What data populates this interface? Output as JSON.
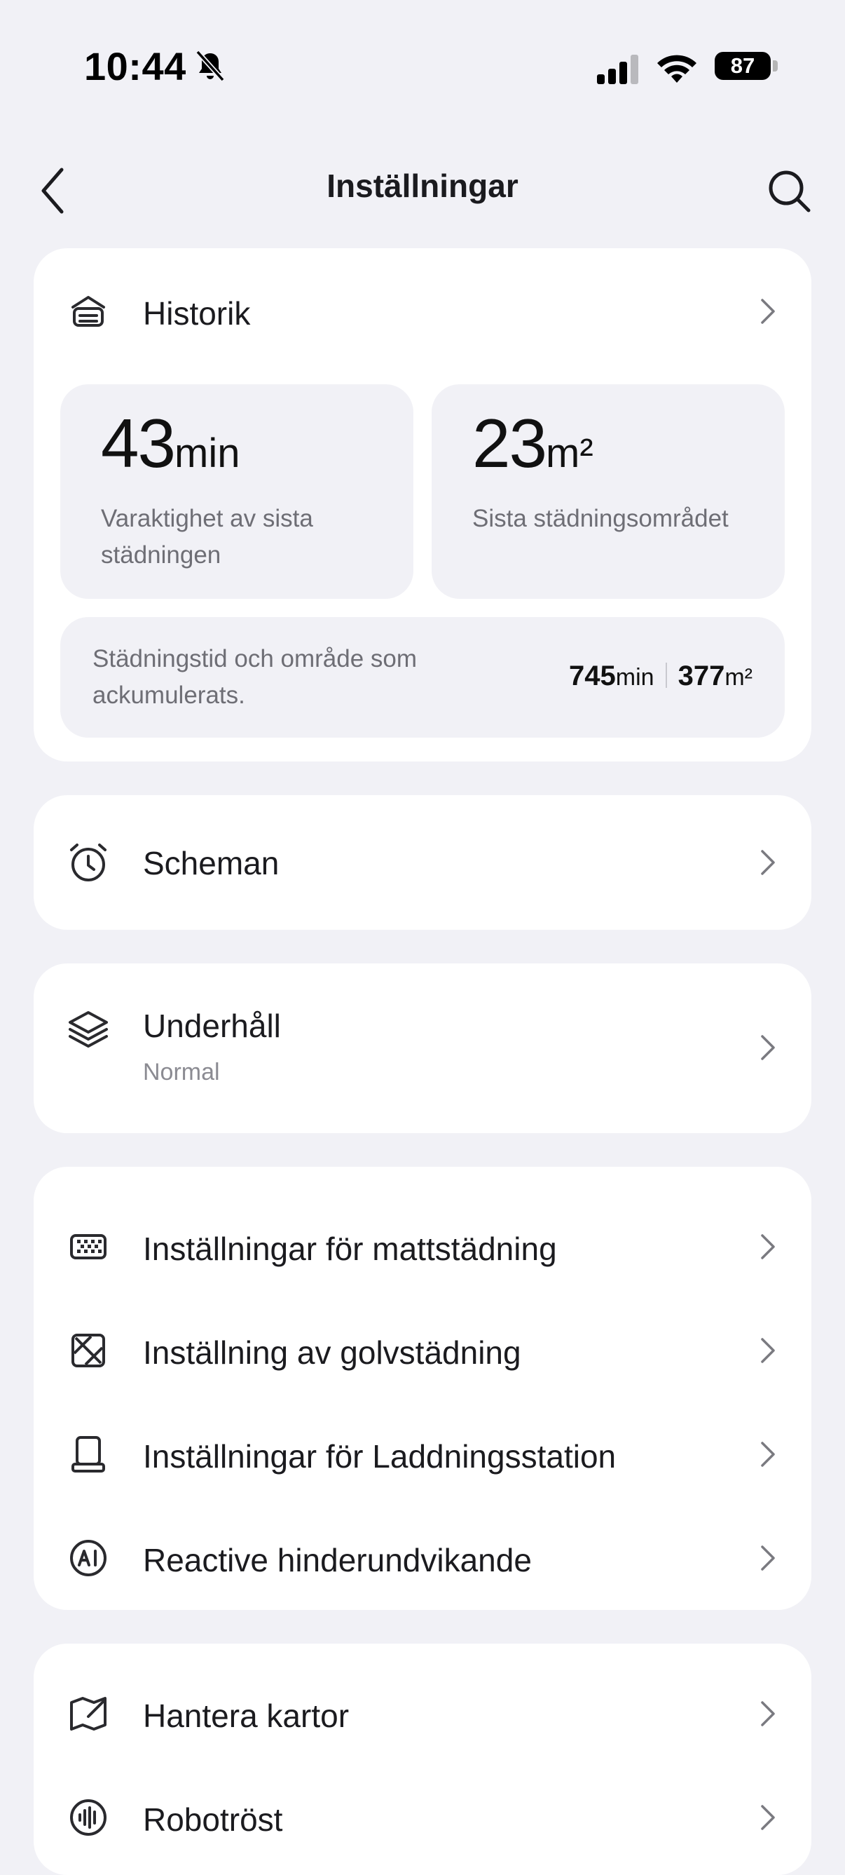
{
  "status_bar": {
    "time": "10:44",
    "battery": "87"
  },
  "nav": {
    "title": "Inställningar"
  },
  "history": {
    "label": "Historik",
    "last_duration": {
      "value": "43",
      "unit": "min",
      "description": "Varaktighet av sista städningen"
    },
    "last_area": {
      "value": "23",
      "unit": "m²",
      "description": "Sista städningsområdet"
    },
    "accumulated": {
      "description": "Städningstid och område som ackumulerats.",
      "time_value": "745",
      "time_unit": "min",
      "area_value": "377",
      "area_unit": "m²"
    }
  },
  "schedules": {
    "label": "Scheman"
  },
  "maintenance": {
    "label": "Underhåll",
    "status": "Normal"
  },
  "cleaning_settings": [
    {
      "label": "Inställningar för mattstädning",
      "icon": "carpet-icon"
    },
    {
      "label": "Inställning av golvstädning",
      "icon": "floor-icon"
    },
    {
      "label": "Inställningar för Laddningsstation",
      "icon": "dock-icon"
    },
    {
      "label": "Reactive hinderundvikande",
      "icon": "ai-icon"
    }
  ],
  "map_settings": [
    {
      "label": "Hantera kartor",
      "icon": "map-icon"
    },
    {
      "label": "Robotröst",
      "icon": "voice-icon"
    }
  ]
}
